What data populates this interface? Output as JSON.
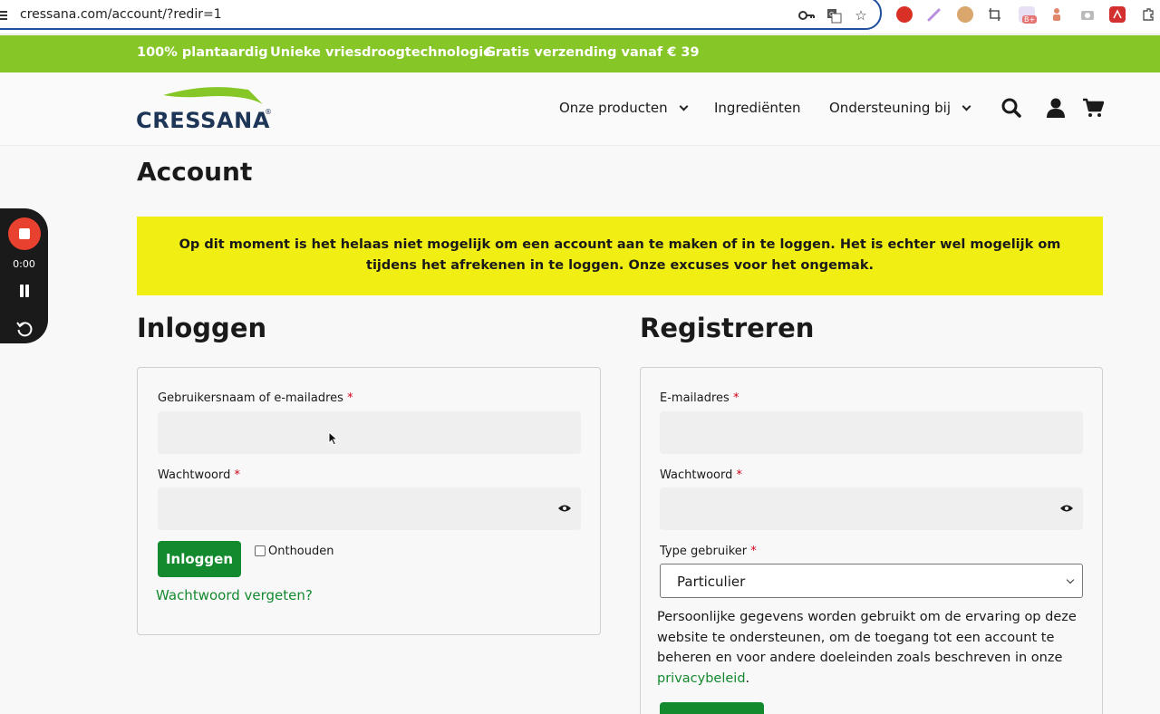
{
  "browser": {
    "url": "cressana.com/account/?redir=1",
    "icons": [
      "key-icon",
      "translate-icon",
      "star-icon"
    ],
    "extensions": [
      "ublock-extension-icon",
      "pen-extension-icon",
      "cookie-extension-icon",
      "crop-extension-icon",
      "badge-extension-icon",
      "figure-extension-icon",
      "camera-extension-icon",
      "pdf-extension-icon",
      "puzzle-extension-icon"
    ]
  },
  "promo": {
    "items": [
      "100% plantaardig",
      "Unieke vriesdroogtechnologie",
      "Gratis verzending vanaf € 39"
    ]
  },
  "header": {
    "logo_text": "CRESSANA",
    "logo_reg": "®",
    "nav": [
      "Onze producten",
      "Ingrediënten",
      "Ondersteuning bij"
    ],
    "icons": [
      "search-icon",
      "user-icon",
      "cart-icon"
    ]
  },
  "recorder": {
    "time": "0:00"
  },
  "page": {
    "title": "Account",
    "notice": "Op dit moment is het helaas niet mogelijk om een account aan te maken of in te loggen. Het is echter wel mogelijk om tijdens het afrekenen in te loggen. Onze excuses voor het ongemak."
  },
  "login": {
    "title": "Inloggen",
    "username_label": "Gebruikersnaam of e-mailadres",
    "password_label": "Wachtwoord",
    "required_mark": "*",
    "submit_label": "Inloggen",
    "remember_label": "Onthouden",
    "forgot_label": "Wachtwoord vergeten?"
  },
  "register": {
    "title": "Registreren",
    "email_label": "E-mailadres",
    "password_label": "Wachtwoord",
    "type_label": "Type gebruiker",
    "type_selected": "Particulier",
    "privacy_text": "Persoonlijke gegevens worden gebruikt om de ervaring op deze website te ondersteunen, om de toegang tot een account te beheren en voor andere doeleinden zoals beschreven in onze",
    "privacy_link": "privacybeleid",
    "privacy_end": "."
  },
  "colors": {
    "promo_green": "#86c627",
    "button_green": "#148a2f",
    "notice_yellow": "#f0ee13",
    "logo_navy": "#1d3557",
    "required_red": "#d0021b"
  }
}
